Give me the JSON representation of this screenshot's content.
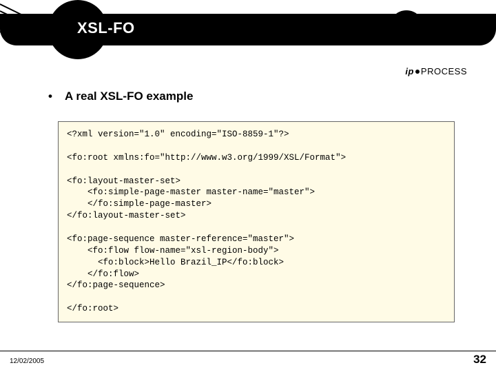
{
  "header": {
    "title": "XSL-FO"
  },
  "logo": {
    "brand_prefix": "ip",
    "brand_main": "PROCESS"
  },
  "bullet": {
    "symbol": "•",
    "text": "A real XSL-FO example"
  },
  "code": {
    "line1": "<?xml version=\"1.0\" encoding=\"ISO-8859-1\"?>",
    "line2": "",
    "line3": "<fo:root xmlns:fo=\"http://www.w3.org/1999/XSL/Format\">",
    "line4": "",
    "line5": "<fo:layout-master-set>",
    "line6": "    <fo:simple-page-master master-name=\"master\">",
    "line7": "    </fo:simple-page-master>",
    "line8": "</fo:layout-master-set>",
    "line9": "",
    "line10": "<fo:page-sequence master-reference=\"master\">",
    "line11": "    <fo:flow flow-name=\"xsl-region-body\">",
    "line12": "      <fo:block>Hello Brazil_IP</fo:block>",
    "line13": "    </fo:flow>",
    "line14": "</fo:page-sequence>",
    "line15": "",
    "line16": "</fo:root>"
  },
  "footer": {
    "date": "12/02/2005",
    "page_number": "32"
  }
}
